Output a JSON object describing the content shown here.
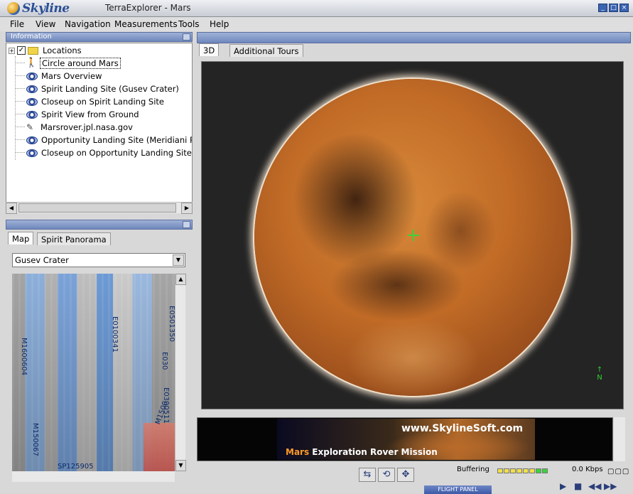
{
  "window": {
    "brand": "Skyline",
    "title": "TerraExplorer - Mars",
    "buttons": [
      "_",
      "□",
      "×"
    ]
  },
  "menu": [
    "File",
    "View",
    "Navigation",
    "Measurements",
    "Tools",
    "Help"
  ],
  "info_panel": {
    "header": "Information",
    "tree": [
      {
        "label": "Locations",
        "icon": "folder-icon",
        "checked": true
      },
      {
        "label": "Circle around Mars",
        "icon": "walker-icon",
        "selected": true
      },
      {
        "label": "Mars Overview",
        "icon": "eye-icon"
      },
      {
        "label": "Spirit Landing Site (Gusev Crater)",
        "icon": "eye-icon"
      },
      {
        "label": "Closeup on Spirit Landing Site",
        "icon": "eye-icon"
      },
      {
        "label": "Spirit View from Ground",
        "icon": "eye-icon"
      },
      {
        "label": "Marsrover.jpl.nasa.gov",
        "icon": "link-icon"
      },
      {
        "label": "Opportunity Landing Site (Meridiani Planu",
        "icon": "eye-icon"
      },
      {
        "label": "Closeup on Opportunity Landing Site",
        "icon": "eye-icon"
      }
    ]
  },
  "map_panel": {
    "tabs": [
      "Map",
      "Spirit Panorama"
    ],
    "dropdown": "Gusev Crater",
    "labels": [
      "M1600604",
      "E0100341",
      "E030",
      "M1500",
      "E0501350",
      "M150067",
      "SP125905",
      "E0300511"
    ]
  },
  "viewer": {
    "tabs": [
      "3D",
      "Additional Tours"
    ],
    "north": "N"
  },
  "banner": {
    "url": "www.SkylineSoft.com",
    "mission_prefix": "Mars",
    "mission_rest": " Exploration Rover Mission"
  },
  "status": {
    "buffering_label": "Buffering",
    "rate": "0.0",
    "rate_unit": "Kbps",
    "flight_panel": "FLIGHT PANEL"
  },
  "colors": {
    "accent": "#3a63b0",
    "crosshair": "#3ad33a",
    "banner_orange": "#ff9a28"
  }
}
